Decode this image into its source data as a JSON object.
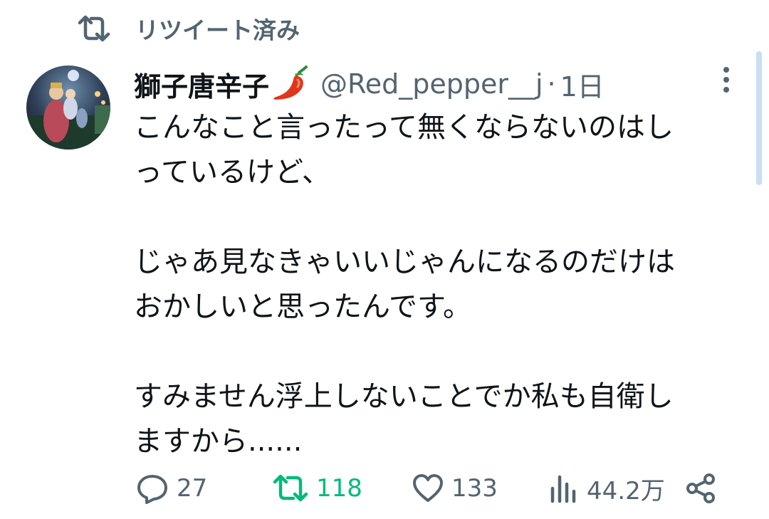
{
  "retweet_context": {
    "label": "リツイート済み"
  },
  "tweet": {
    "display_name": "獅子唐辛子",
    "handle": "@Red_pepper__j",
    "separator": "·",
    "time": "1日",
    "text": "こんなこと言ったって無くならないのはし\nっているけど、\n\nじゃあ見なきゃいいじゃんになるのだけは\nおかしいと思ったんです。\n\nすみません浮上しないことでか私も自衛し\nますから......"
  },
  "actions": {
    "reply_count": "27",
    "retweet_count": "118",
    "like_count": "133",
    "views_count": "44.2万"
  },
  "colors": {
    "text": "#0f1419",
    "secondary": "#536471",
    "retweet_green": "#00ba7c",
    "scrollbar": "#c9def2"
  },
  "icons": [
    "retweet-icon",
    "pepper-emoji-icon",
    "more-options-icon",
    "reply-icon",
    "like-icon",
    "views-icon",
    "share-icon"
  ]
}
